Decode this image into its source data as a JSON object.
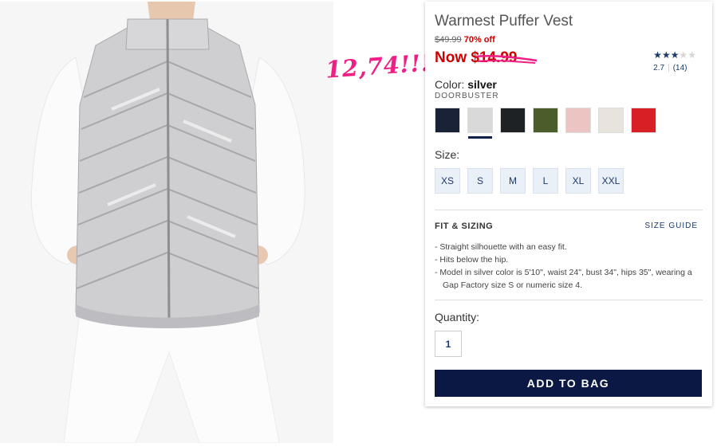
{
  "annotation": {
    "text": "12,74!!!"
  },
  "product": {
    "title": "Warmest Puffer Vest",
    "original_price": "$49.99",
    "discount": "70% off",
    "now_price": "Now $14.99",
    "rating_value": "2.7",
    "rating_count": "(14)",
    "rating_stars_filled": 3,
    "rating_stars_total": 5
  },
  "color": {
    "label": "Color:",
    "selected_name": "silver",
    "tag": "DOORBUSTER",
    "swatches": [
      {
        "name": "navy",
        "color": "#1a2238"
      },
      {
        "name": "silver",
        "color": "#d9d9d9"
      },
      {
        "name": "black",
        "color": "#1f2224"
      },
      {
        "name": "olive",
        "color": "#4b5d2a"
      },
      {
        "name": "pink",
        "color": "#ecc5c3"
      },
      {
        "name": "ivory",
        "color": "#e8e4dd"
      },
      {
        "name": "red",
        "color": "#d81f26"
      }
    ],
    "selected_index": 1
  },
  "size": {
    "label": "Size:",
    "options": [
      "XS",
      "S",
      "M",
      "L",
      "XL",
      "XXL"
    ]
  },
  "fit": {
    "title": "FIT & SIZING",
    "guide_link": "SIZE GUIDE",
    "bullets": [
      "Straight silhouette with an easy fit.",
      "Hits below the hip.",
      "Model in silver color is 5'10\", waist 24\", bust 34\", hips 35\", wearing a Gap Factory size S or numeric size 4."
    ]
  },
  "quantity": {
    "label": "Quantity:",
    "value": "1"
  },
  "cta": {
    "label": "ADD TO BAG",
    "color": "#0b1844"
  }
}
